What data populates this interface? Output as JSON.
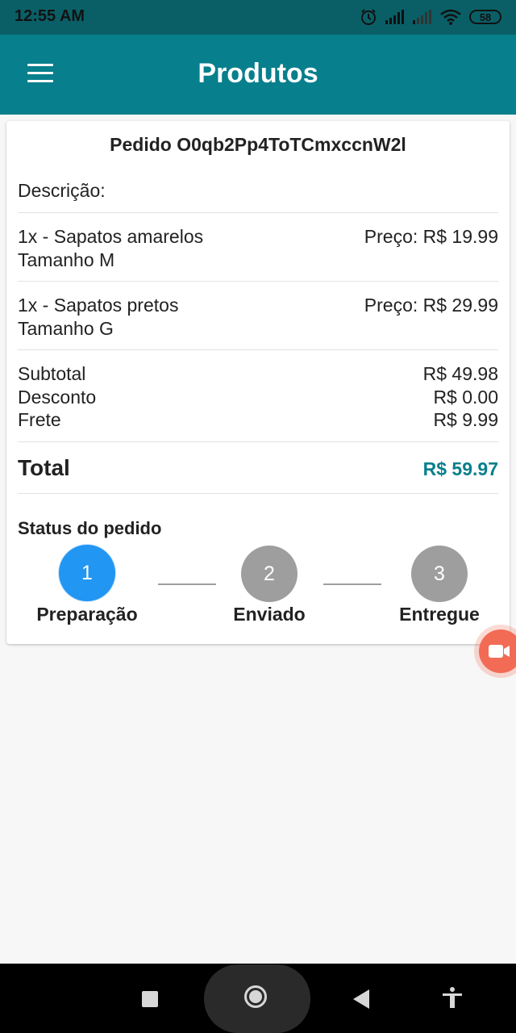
{
  "status_bar": {
    "time": "12:55 AM",
    "battery": "58",
    "icons": [
      "alarm-icon",
      "signal-icon",
      "signal-weak-icon",
      "wifi-icon",
      "battery-icon"
    ]
  },
  "app_bar": {
    "title": "Produtos",
    "menu_icon": "menu-icon"
  },
  "order": {
    "title": "Pedido O0qb2Pp4ToTCmxccnW2l",
    "description_label": "Descrição:",
    "items": [
      {
        "name": "1x - Sapatos amarelos",
        "size": "Tamanho M",
        "price": "Preço: R$ 19.99"
      },
      {
        "name": "1x - Sapatos pretos",
        "size": "Tamanho G",
        "price": "Preço: R$ 29.99"
      }
    ],
    "summary": [
      {
        "label": "Subtotal",
        "value": "R$ 49.98"
      },
      {
        "label": "Desconto",
        "value": "R$ 0.00"
      },
      {
        "label": "Frete",
        "value": "R$ 9.99"
      }
    ],
    "total_label": "Total",
    "total_value": "R$ 59.97",
    "total_color": "#087f8c"
  },
  "status": {
    "title": "Status do pedido",
    "steps": [
      {
        "number": "1",
        "label": "Preparação",
        "active": true
      },
      {
        "number": "2",
        "label": "Enviado",
        "active": false
      },
      {
        "number": "3",
        "label": "Entregue",
        "active": false
      }
    ]
  },
  "colors": {
    "app_bar": "#087f8c",
    "status_bar": "#0a5f66",
    "active_step": "#2196f3",
    "inactive_step": "#9e9e9e"
  },
  "floating_button": {
    "icon": "video-record-icon"
  },
  "nav_bar": {
    "icons": [
      "recent-apps-icon",
      "home-icon",
      "back-icon",
      "accessibility-icon"
    ]
  }
}
